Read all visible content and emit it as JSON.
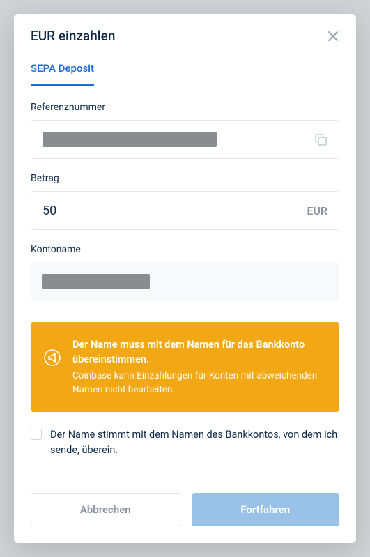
{
  "modal": {
    "title": "EUR einzahlen",
    "tab_label": "SEPA Deposit"
  },
  "fields": {
    "reference_label": "Referenznummer",
    "amount_label": "Betrag",
    "amount_value": "50",
    "amount_currency": "EUR",
    "account_label": "Kontoname"
  },
  "warning": {
    "bold": "Der Name muss mit dem Namen für das Bankkonto übereinstimmen.",
    "text": "Coinbase kann Einzahlungen für Konten mit abweichenden Namen nicht bearbeiten."
  },
  "confirm": {
    "label": "Der Name stimmt mit dem Namen des Bankkontos, von dem ich sende, überein."
  },
  "actions": {
    "cancel": "Abbrechen",
    "continue": "Fortfahren"
  }
}
